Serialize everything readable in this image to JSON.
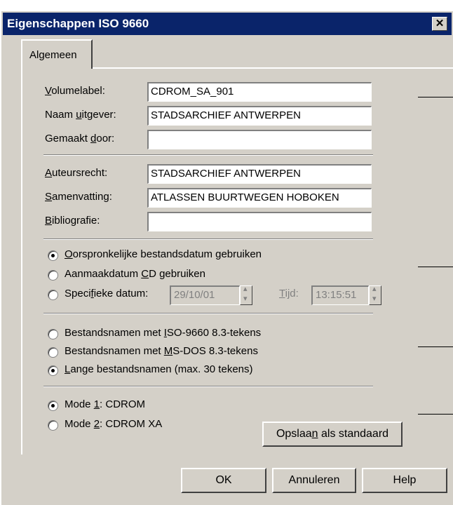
{
  "window": {
    "title": "Eigenschappen ISO 9660",
    "close_glyph": "✕"
  },
  "tabs": [
    {
      "label": "Algemeen"
    }
  ],
  "fields": {
    "volumelabel": {
      "label_key": "V",
      "label_rest": "olumelabel:",
      "value": "CDROM_SA_901"
    },
    "uitgever": {
      "label_pre": "Naam ",
      "label_key": "u",
      "label_rest": "itgever:",
      "value": "STADSARCHIEF ANTWERPEN"
    },
    "gemaakt": {
      "label_pre": "Gemaakt ",
      "label_key": "d",
      "label_rest": "oor:",
      "value": ""
    },
    "auteursrecht": {
      "label_key": "A",
      "label_rest": "uteursrecht:",
      "value": "STADSARCHIEF ANTWERPEN"
    },
    "samenvatting": {
      "label_key": "S",
      "label_rest": "amenvatting:",
      "value": "ATLASSEN BUURTWEGEN HOBOKEN"
    },
    "bibliografie": {
      "label_key": "B",
      "label_rest": "ibliografie:",
      "value": ""
    }
  },
  "date_options": {
    "opt1": {
      "label_key": "O",
      "label_rest": "orspronkelijke bestandsdatum gebruiken",
      "checked": true
    },
    "opt2": {
      "label_pre": "Aanmaakdatum ",
      "label_key": "C",
      "label_rest": "D gebruiken",
      "checked": false
    },
    "opt3": {
      "label_pre": "Speci",
      "label_key": "f",
      "label_rest": "ieke datum:",
      "checked": false
    },
    "date_value": "29/10/01",
    "time_label_key": "T",
    "time_label_rest": "ijd:",
    "time_value": "13:15:51"
  },
  "name_options": {
    "opt1": {
      "label_pre": "Bestandsnamen met ",
      "label_key": "I",
      "label_rest": "SO-9660 8.3-tekens",
      "checked": false
    },
    "opt2": {
      "label_pre": "Bestandsnamen met ",
      "label_key": "M",
      "label_rest": "S-DOS 8.3-tekens",
      "checked": false
    },
    "opt3": {
      "label_key": "L",
      "label_rest": "ange bestandsnamen (max. 30 tekens)",
      "checked": true
    }
  },
  "mode_options": {
    "opt1": {
      "label_pre": "Mode ",
      "label_key": "1",
      "label_rest": ": CDROM",
      "checked": true
    },
    "opt2": {
      "label_pre": "Mode ",
      "label_key": "2",
      "label_rest": ": CDROM XA",
      "checked": false
    }
  },
  "buttons": {
    "save_default": {
      "label_pre": "Opslaa",
      "label_key": "n",
      "label_rest": " als standaard"
    },
    "ok": "OK",
    "annuleren": "Annuleren",
    "help": "Help"
  },
  "colors": {
    "titlebar": "#0a246a",
    "face": "#d4d0c8"
  }
}
